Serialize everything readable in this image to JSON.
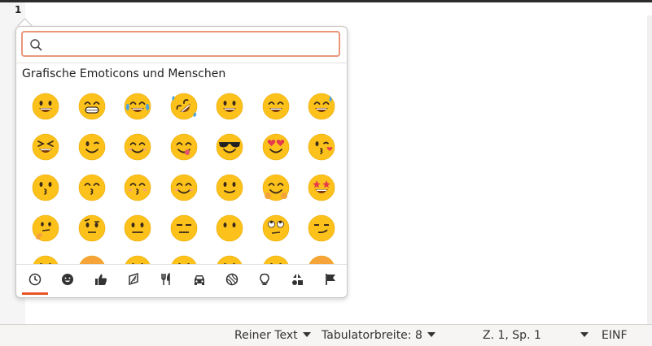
{
  "editor": {
    "line_number": "1"
  },
  "emoji_chooser": {
    "search": {
      "value": "",
      "placeholder": ""
    },
    "section_title": "Grafische Emoticons und Menschen",
    "emojis": [
      {
        "name": "grinning-face",
        "kind": "grin"
      },
      {
        "name": "beaming-face",
        "kind": "teeth"
      },
      {
        "name": "face-with-tears-of-joy",
        "kind": "tears"
      },
      {
        "name": "rolling-on-floor-laughing",
        "kind": "rofl"
      },
      {
        "name": "grinning-face-big-eyes",
        "kind": "grin"
      },
      {
        "name": "grinning-face-smiling-eyes",
        "kind": "smileeyes"
      },
      {
        "name": "grinning-face-with-sweat",
        "kind": "sweat"
      },
      {
        "name": "squinting-face",
        "kind": "squint"
      },
      {
        "name": "winking-face",
        "kind": "wink"
      },
      {
        "name": "smiling-face-smiling-eyes",
        "kind": "smile"
      },
      {
        "name": "face-savoring-food",
        "kind": "yum"
      },
      {
        "name": "smiling-face-sunglasses",
        "kind": "cool"
      },
      {
        "name": "heart-eyes",
        "kind": "hearts"
      },
      {
        "name": "face-blowing-kiss",
        "kind": "blowkiss"
      },
      {
        "name": "kissing-face",
        "kind": "kiss"
      },
      {
        "name": "kissing-face-smiling-eyes",
        "kind": "kisssmile"
      },
      {
        "name": "kissing-face-closed-eyes",
        "kind": "kissclosed"
      },
      {
        "name": "smiling-face",
        "kind": "relaxed"
      },
      {
        "name": "slightly-smiling-face",
        "kind": "slight"
      },
      {
        "name": "hugging-face",
        "kind": "hug"
      },
      {
        "name": "star-struck",
        "kind": "stars"
      },
      {
        "name": "thinking-face",
        "kind": "think"
      },
      {
        "name": "face-raised-eyebrow",
        "kind": "eyebrow"
      },
      {
        "name": "neutral-face",
        "kind": "neutral"
      },
      {
        "name": "expressionless-face",
        "kind": "expressionless"
      },
      {
        "name": "face-without-mouth",
        "kind": "nomouth"
      },
      {
        "name": "face-rolling-eyes",
        "kind": "rolleyes"
      },
      {
        "name": "smirking-face",
        "kind": "smirk"
      },
      {
        "name": "partial-1",
        "kind": "slight"
      },
      {
        "name": "partial-2",
        "kind": "orange"
      },
      {
        "name": "partial-3",
        "kind": "neutral"
      },
      {
        "name": "partial-4",
        "kind": "neutral"
      },
      {
        "name": "partial-5",
        "kind": "slight"
      },
      {
        "name": "partial-6",
        "kind": "slight"
      },
      {
        "name": "partial-7",
        "kind": "orange"
      }
    ],
    "categories": [
      {
        "name": "recent",
        "icon": "clock-icon",
        "active": true
      },
      {
        "name": "smileys",
        "icon": "smiley-icon",
        "active": false
      },
      {
        "name": "body",
        "icon": "thumbs-up-icon",
        "active": false
      },
      {
        "name": "nature",
        "icon": "leaf-icon",
        "active": false
      },
      {
        "name": "food",
        "icon": "fork-knife-icon",
        "active": false
      },
      {
        "name": "travel",
        "icon": "car-icon",
        "active": false
      },
      {
        "name": "activities",
        "icon": "ball-icon",
        "active": false
      },
      {
        "name": "objects",
        "icon": "lightbulb-icon",
        "active": false
      },
      {
        "name": "symbols",
        "icon": "symbols-icon",
        "active": false
      },
      {
        "name": "flags",
        "icon": "flag-icon",
        "active": false
      }
    ],
    "accent_color": "#e95420",
    "search_border_color": "#e9967a"
  },
  "statusbar": {
    "syntax": "Reiner Text",
    "tab_width": "Tabulatorbreite: 8",
    "cursor_position": "Z. 1, Sp. 1",
    "insert_mode": "EINF"
  }
}
